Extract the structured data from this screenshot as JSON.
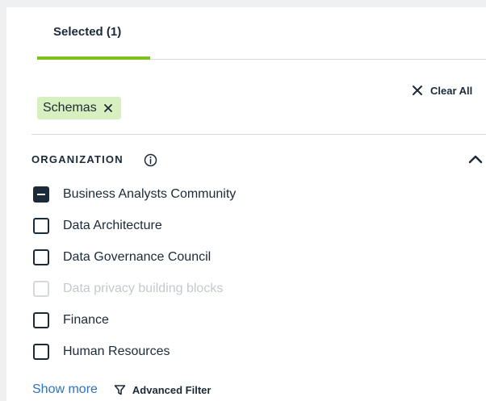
{
  "tabs": {
    "selected_label": "Selected (1)"
  },
  "clear_all": {
    "label": "Clear All",
    "icon": "close-icon"
  },
  "chips": [
    {
      "label": "Schemas",
      "remove_icon": "close-icon"
    }
  ],
  "section": {
    "title": "ORGANIZATION",
    "info_icon": "info-icon",
    "collapse_icon": "chevron-up-icon",
    "options": [
      {
        "label": "Business Analysts Community",
        "state": "indeterminate"
      },
      {
        "label": "Data Architecture",
        "state": "unchecked"
      },
      {
        "label": "Data Governance Council",
        "state": "unchecked"
      },
      {
        "label": "Data privacy building blocks",
        "state": "disabled"
      },
      {
        "label": "Finance",
        "state": "unchecked"
      },
      {
        "label": "Human Resources",
        "state": "unchecked"
      }
    ]
  },
  "footer": {
    "show_more": "Show more",
    "advanced_filter": "Advanced Filter",
    "advanced_filter_icon": "funnel-icon"
  },
  "colors": {
    "accent_green": "#7cc21f",
    "chip_bg": "#d8efc0",
    "text_dark": "#1b2a38",
    "link_blue": "#2f73bd",
    "disabled_text": "#c4c9cf"
  }
}
